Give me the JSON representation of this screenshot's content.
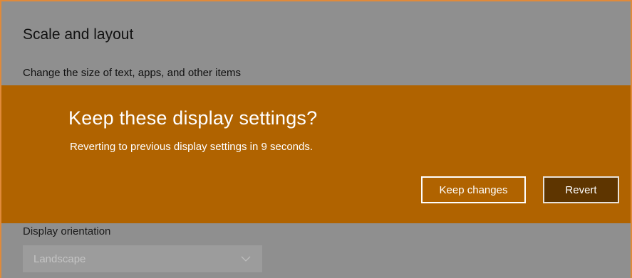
{
  "settings": {
    "section_title": "Scale and layout",
    "section_subtitle": "Change the size of text, apps, and other items",
    "orientation_label": "Display orientation",
    "orientation_value": "Landscape",
    "chevron_icon": "chevron-down-icon"
  },
  "dialog": {
    "title": "Keep these display settings?",
    "message": "Reverting to previous display settings in  9 seconds.",
    "countdown_seconds": 9,
    "keep_label": "Keep changes",
    "revert_label": "Revert",
    "accent_color": "#b06300",
    "revert_color": "#5e3500"
  },
  "colors": {
    "dimmed_background": "#8f8f8f",
    "window_border": "#e08a3a"
  }
}
